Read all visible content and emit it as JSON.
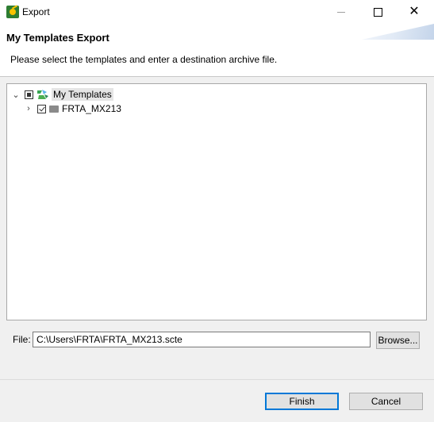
{
  "window": {
    "title": "Export",
    "icon": "app-icon"
  },
  "header": {
    "title": "My Templates Export",
    "description": "Please select the templates and enter a destination archive file."
  },
  "tree": {
    "root": {
      "label": "My Templates",
      "expanded": true,
      "check_state": "partial",
      "icon": "templates-icon"
    },
    "children": [
      {
        "label": "FRTA_MX213",
        "expanded": false,
        "check_state": "checked",
        "icon": "folder-icon"
      }
    ]
  },
  "file": {
    "label": "File:",
    "value": "C:\\Users\\FRTA\\FRTA_MX213.scte"
  },
  "buttons": {
    "browse": "Browse...",
    "finish": "Finish",
    "cancel": "Cancel"
  },
  "colors": {
    "accent": "#0078d7",
    "dialog_bg": "#f0f0f0"
  }
}
